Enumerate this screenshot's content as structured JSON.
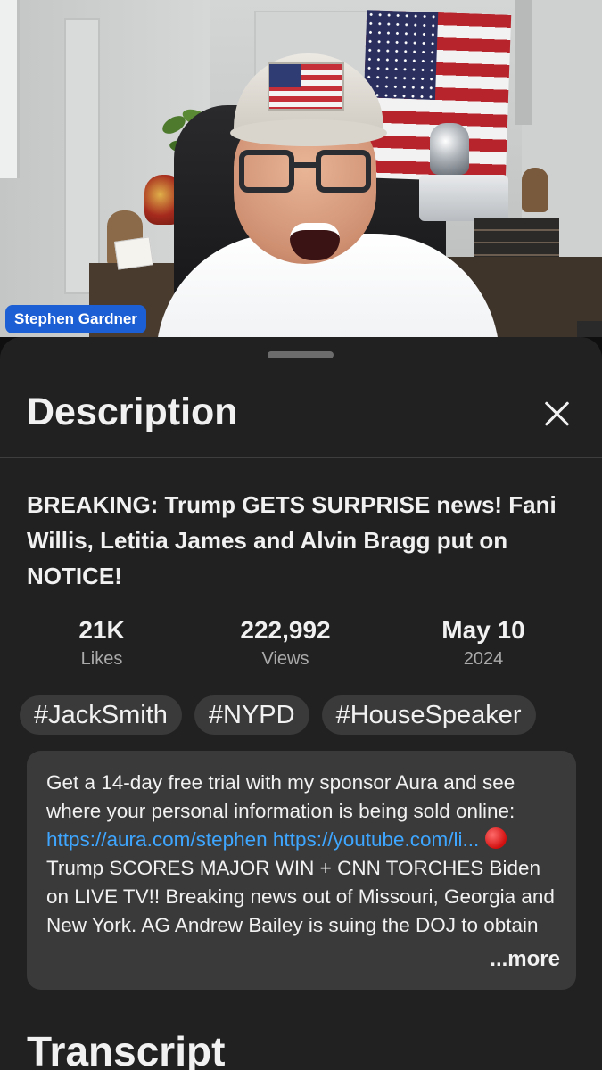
{
  "video": {
    "presenter_name": "Stephen Gardner"
  },
  "sheet": {
    "title": "Description",
    "close_icon": "close-icon",
    "video_title": "BREAKING: Trump GETS SURPRISE news! Fani Willis, Letitia James and Alvin Bragg put on NOTICE!",
    "stats": [
      {
        "value": "21K",
        "label": "Likes"
      },
      {
        "value": "222,992",
        "label": "Views"
      },
      {
        "value": "May 10",
        "label": "2024"
      }
    ],
    "hashtags": [
      "#JackSmith",
      "#NYPD",
      "#HouseSpeaker"
    ],
    "description": {
      "text_before_link": "Get a 14-day free trial with my sponsor Aura and see where your personal information is being sold online: ",
      "link1": "https://aura.com/stephen",
      "link2": "https://youtube.com/li...",
      "text_after_link": "Trump SCORES MAJOR WIN + CNN TORCHES Biden on LIVE TV!!  Breaking news out of Missouri, Georgia and New York. AG Andrew Bailey is suing the DOJ to obtain",
      "emoji_icon": "red-circle-icon",
      "more_label": "...more"
    },
    "next_section_title": "Transcript"
  },
  "colors": {
    "background": "#0f0f0f",
    "sheet": "#212121",
    "chip": "#3a3a3a",
    "link": "#3ea6ff",
    "badge": "#1c5fd4"
  }
}
